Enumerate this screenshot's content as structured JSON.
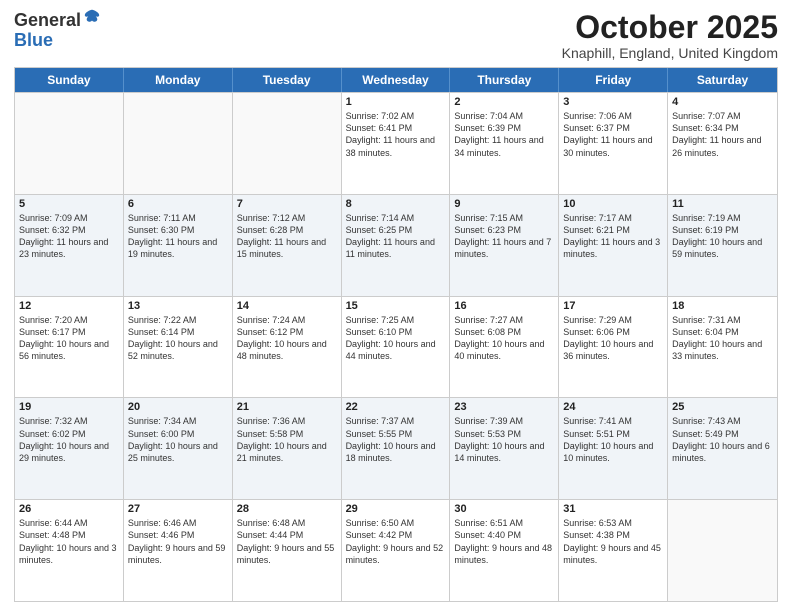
{
  "logo": {
    "general": "General",
    "blue": "Blue"
  },
  "header": {
    "month": "October 2025",
    "location": "Knaphill, England, United Kingdom"
  },
  "days": [
    "Sunday",
    "Monday",
    "Tuesday",
    "Wednesday",
    "Thursday",
    "Friday",
    "Saturday"
  ],
  "weeks": [
    [
      {
        "day": "",
        "empty": true
      },
      {
        "day": "",
        "empty": true
      },
      {
        "day": "",
        "empty": true
      },
      {
        "day": "1",
        "sunrise": "Sunrise: 7:02 AM",
        "sunset": "Sunset: 6:41 PM",
        "daylight": "Daylight: 11 hours and 38 minutes."
      },
      {
        "day": "2",
        "sunrise": "Sunrise: 7:04 AM",
        "sunset": "Sunset: 6:39 PM",
        "daylight": "Daylight: 11 hours and 34 minutes."
      },
      {
        "day": "3",
        "sunrise": "Sunrise: 7:06 AM",
        "sunset": "Sunset: 6:37 PM",
        "daylight": "Daylight: 11 hours and 30 minutes."
      },
      {
        "day": "4",
        "sunrise": "Sunrise: 7:07 AM",
        "sunset": "Sunset: 6:34 PM",
        "daylight": "Daylight: 11 hours and 26 minutes."
      }
    ],
    [
      {
        "day": "5",
        "sunrise": "Sunrise: 7:09 AM",
        "sunset": "Sunset: 6:32 PM",
        "daylight": "Daylight: 11 hours and 23 minutes."
      },
      {
        "day": "6",
        "sunrise": "Sunrise: 7:11 AM",
        "sunset": "Sunset: 6:30 PM",
        "daylight": "Daylight: 11 hours and 19 minutes."
      },
      {
        "day": "7",
        "sunrise": "Sunrise: 7:12 AM",
        "sunset": "Sunset: 6:28 PM",
        "daylight": "Daylight: 11 hours and 15 minutes."
      },
      {
        "day": "8",
        "sunrise": "Sunrise: 7:14 AM",
        "sunset": "Sunset: 6:25 PM",
        "daylight": "Daylight: 11 hours and 11 minutes."
      },
      {
        "day": "9",
        "sunrise": "Sunrise: 7:15 AM",
        "sunset": "Sunset: 6:23 PM",
        "daylight": "Daylight: 11 hours and 7 minutes."
      },
      {
        "day": "10",
        "sunrise": "Sunrise: 7:17 AM",
        "sunset": "Sunset: 6:21 PM",
        "daylight": "Daylight: 11 hours and 3 minutes."
      },
      {
        "day": "11",
        "sunrise": "Sunrise: 7:19 AM",
        "sunset": "Sunset: 6:19 PM",
        "daylight": "Daylight: 10 hours and 59 minutes."
      }
    ],
    [
      {
        "day": "12",
        "sunrise": "Sunrise: 7:20 AM",
        "sunset": "Sunset: 6:17 PM",
        "daylight": "Daylight: 10 hours and 56 minutes."
      },
      {
        "day": "13",
        "sunrise": "Sunrise: 7:22 AM",
        "sunset": "Sunset: 6:14 PM",
        "daylight": "Daylight: 10 hours and 52 minutes."
      },
      {
        "day": "14",
        "sunrise": "Sunrise: 7:24 AM",
        "sunset": "Sunset: 6:12 PM",
        "daylight": "Daylight: 10 hours and 48 minutes."
      },
      {
        "day": "15",
        "sunrise": "Sunrise: 7:25 AM",
        "sunset": "Sunset: 6:10 PM",
        "daylight": "Daylight: 10 hours and 44 minutes."
      },
      {
        "day": "16",
        "sunrise": "Sunrise: 7:27 AM",
        "sunset": "Sunset: 6:08 PM",
        "daylight": "Daylight: 10 hours and 40 minutes."
      },
      {
        "day": "17",
        "sunrise": "Sunrise: 7:29 AM",
        "sunset": "Sunset: 6:06 PM",
        "daylight": "Daylight: 10 hours and 36 minutes."
      },
      {
        "day": "18",
        "sunrise": "Sunrise: 7:31 AM",
        "sunset": "Sunset: 6:04 PM",
        "daylight": "Daylight: 10 hours and 33 minutes."
      }
    ],
    [
      {
        "day": "19",
        "sunrise": "Sunrise: 7:32 AM",
        "sunset": "Sunset: 6:02 PM",
        "daylight": "Daylight: 10 hours and 29 minutes."
      },
      {
        "day": "20",
        "sunrise": "Sunrise: 7:34 AM",
        "sunset": "Sunset: 6:00 PM",
        "daylight": "Daylight: 10 hours and 25 minutes."
      },
      {
        "day": "21",
        "sunrise": "Sunrise: 7:36 AM",
        "sunset": "Sunset: 5:58 PM",
        "daylight": "Daylight: 10 hours and 21 minutes."
      },
      {
        "day": "22",
        "sunrise": "Sunrise: 7:37 AM",
        "sunset": "Sunset: 5:55 PM",
        "daylight": "Daylight: 10 hours and 18 minutes."
      },
      {
        "day": "23",
        "sunrise": "Sunrise: 7:39 AM",
        "sunset": "Sunset: 5:53 PM",
        "daylight": "Daylight: 10 hours and 14 minutes."
      },
      {
        "day": "24",
        "sunrise": "Sunrise: 7:41 AM",
        "sunset": "Sunset: 5:51 PM",
        "daylight": "Daylight: 10 hours and 10 minutes."
      },
      {
        "day": "25",
        "sunrise": "Sunrise: 7:43 AM",
        "sunset": "Sunset: 5:49 PM",
        "daylight": "Daylight: 10 hours and 6 minutes."
      }
    ],
    [
      {
        "day": "26",
        "sunrise": "Sunrise: 6:44 AM",
        "sunset": "Sunset: 4:48 PM",
        "daylight": "Daylight: 10 hours and 3 minutes."
      },
      {
        "day": "27",
        "sunrise": "Sunrise: 6:46 AM",
        "sunset": "Sunset: 4:46 PM",
        "daylight": "Daylight: 9 hours and 59 minutes."
      },
      {
        "day": "28",
        "sunrise": "Sunrise: 6:48 AM",
        "sunset": "Sunset: 4:44 PM",
        "daylight": "Daylight: 9 hours and 55 minutes."
      },
      {
        "day": "29",
        "sunrise": "Sunrise: 6:50 AM",
        "sunset": "Sunset: 4:42 PM",
        "daylight": "Daylight: 9 hours and 52 minutes."
      },
      {
        "day": "30",
        "sunrise": "Sunrise: 6:51 AM",
        "sunset": "Sunset: 4:40 PM",
        "daylight": "Daylight: 9 hours and 48 minutes."
      },
      {
        "day": "31",
        "sunrise": "Sunrise: 6:53 AM",
        "sunset": "Sunset: 4:38 PM",
        "daylight": "Daylight: 9 hours and 45 minutes."
      },
      {
        "day": "",
        "empty": true
      }
    ]
  ]
}
